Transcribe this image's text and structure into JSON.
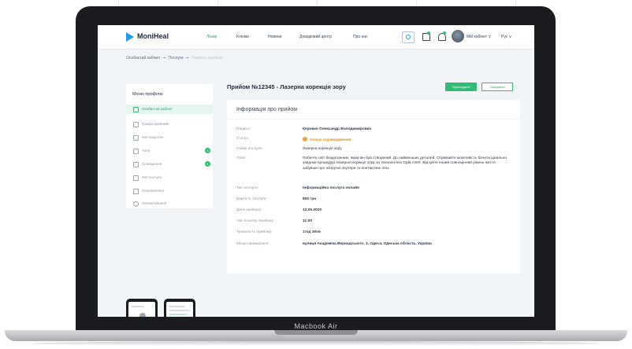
{
  "header": {
    "logo": "MoniHeal",
    "nav": [
      {
        "label": "Лікарі",
        "active": true
      },
      {
        "label": "Клініки",
        "active": false
      },
      {
        "label": "Новини",
        "active": false
      },
      {
        "label": "Довідковий центр",
        "active": false
      },
      {
        "label": "Про нас",
        "active": false
      }
    ],
    "user_name": "Мій кабінет ∨",
    "language": "Рус ∨"
  },
  "breadcrumb": {
    "items": [
      "Особистий кабінет",
      "Послуги",
      "Лазерна корекція"
    ]
  },
  "sidebar": {
    "title": "Меню профілю",
    "items": [
      {
        "label": "Особистий кабінет",
        "active": true,
        "badge": ""
      },
      {
        "label": "Графік прийомів",
        "active": false,
        "badge": ""
      },
      {
        "label": "Мої пацієнти",
        "active": false,
        "badge": ""
      },
      {
        "label": "Чати",
        "active": false,
        "badge": "3"
      },
      {
        "label": "Сповіщення",
        "active": false,
        "badge": "1"
      },
      {
        "label": "Мої послуги",
        "active": false,
        "badge": ""
      },
      {
        "label": "Направлення",
        "active": false,
        "badge": ""
      },
      {
        "label": "Налаштування",
        "active": false,
        "badge": ""
      }
    ]
  },
  "main": {
    "title": "Прийом №12345 - Лазерна корекція зору",
    "confirm_button": "Підтвердити",
    "cancel_button": "Скасувати",
    "card_title": "Інформація про прийом",
    "fields": [
      {
        "key": "Пацієнт:",
        "value": "Керовко Олександр Володимирович",
        "bold": true
      },
      {
        "key": "Статус:",
        "value": "Очікує підтвердження",
        "status": true
      },
      {
        "key": "Назва послуги:",
        "value": "Лазерна корекція зору",
        "bold": false
      },
      {
        "key": "Опис:",
        "value": "Побачте світ бездоганним, яким він був створений. До найменших деталей. Отримайте можливість бачити ідеально завдяки процедурі лазерної корекції зору за технологією OptiLASIK. Відчуйте інший повноцінний рівень життя, забувши про незручні окуляри та контактних лінз.",
        "multi": true
      },
      {
        "key": "Тип послуги:",
        "value": "Інформаційна послуга онлайн",
        "bold": true
      },
      {
        "key": "Вартість послуги:",
        "value": "800 грн",
        "bold": true
      },
      {
        "key": "Дата прийому:",
        "value": "12.05.2020",
        "bold": true
      },
      {
        "key": "Час початку прийому:",
        "value": "11:00",
        "bold": true
      },
      {
        "key": "Тривалість прийому:",
        "value": "1год 30хв",
        "bold": true
      },
      {
        "key": "Місце проведення:",
        "value": "вулиця Академіка Вернадського, 3, Одеса, Одеська область, Україна",
        "bold": true
      }
    ]
  },
  "device_label": "Macbook Air",
  "colors": {
    "accent": "#2ebd73",
    "brand": "#1a9cf0",
    "status": "#f2a23a"
  }
}
